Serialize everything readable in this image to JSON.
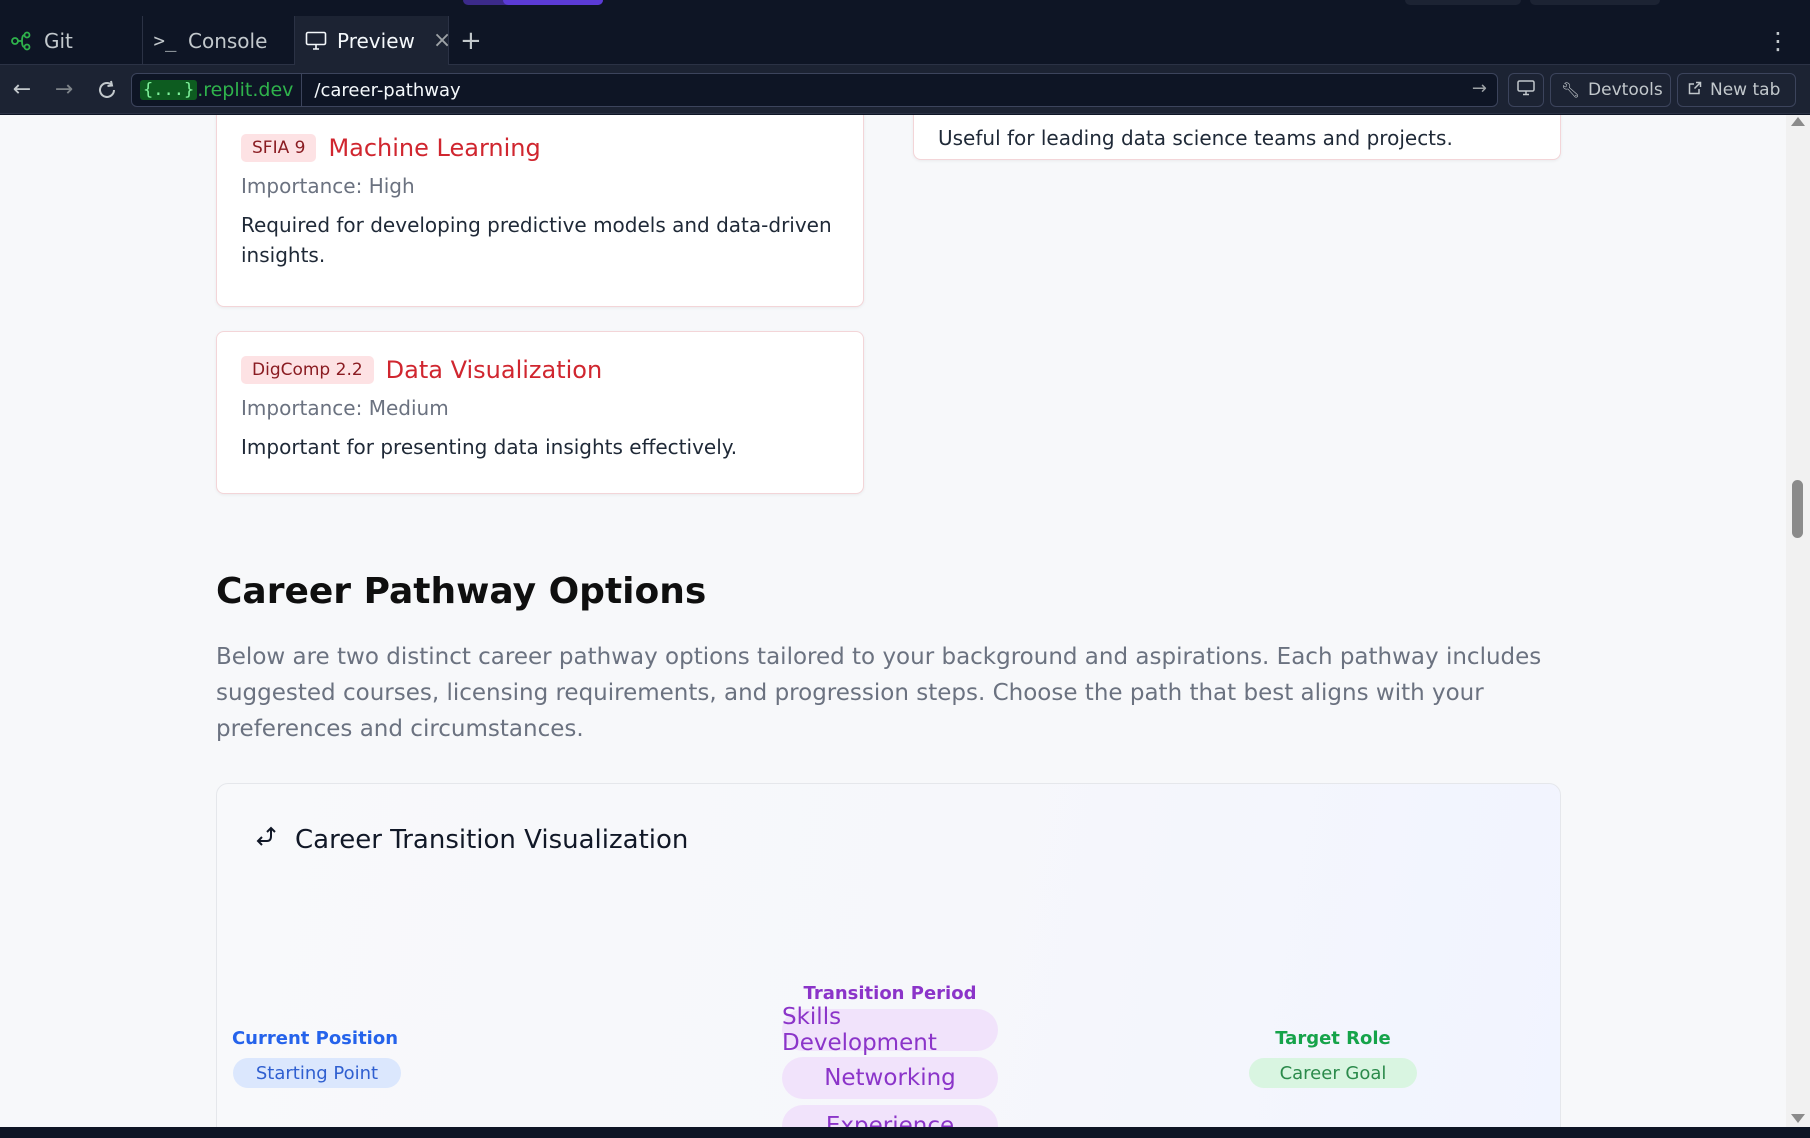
{
  "ide": {
    "tabs": [
      {
        "label": "Git",
        "icon": "git-branch-icon"
      },
      {
        "label": "Console",
        "icon": "terminal-icon"
      },
      {
        "label": "Preview",
        "icon": "monitor-icon",
        "active": true
      }
    ],
    "add_tab": "+",
    "menu": "⋮"
  },
  "urlbar": {
    "host_brace": "{...}",
    "host": ".replit.dev",
    "path": "/career-pathway",
    "devtools_label": "Devtools",
    "new_tab_label": "New tab"
  },
  "page": {
    "cards": [
      {
        "badge": "",
        "title": "",
        "importance": "",
        "description": "Useful for leading data science teams and projects."
      },
      {
        "badge": "SFIA 9",
        "title": "Machine Learning",
        "importance": "Importance: High",
        "description": "Required for developing predictive models and data-driven insights."
      },
      {
        "badge": "DigComp 2.2",
        "title": "Data Visualization",
        "importance": "Importance: Medium",
        "description": "Important for presenting data insights effectively."
      }
    ],
    "section": {
      "title": "Career Pathway Options",
      "intro": "Below are two distinct career pathway options tailored to your background and aspirations. Each pathway includes suggested courses, licensing requirements, and progression steps. Choose the path that best aligns with your preferences and circumstances."
    },
    "visualization": {
      "title": "Career Transition Visualization",
      "current": {
        "label": "Current Position",
        "tag": "Starting Point"
      },
      "transition": {
        "label": "Transition Period",
        "steps": [
          "Skills Development",
          "Networking",
          "Experience"
        ]
      },
      "target": {
        "label": "Target Role",
        "tag": "Career Goal"
      }
    }
  },
  "colors": {
    "accent_red": "#d0262f",
    "current_blue": "#2563eb",
    "transition_purple": "#8b34c9",
    "target_green": "#16a34a"
  }
}
